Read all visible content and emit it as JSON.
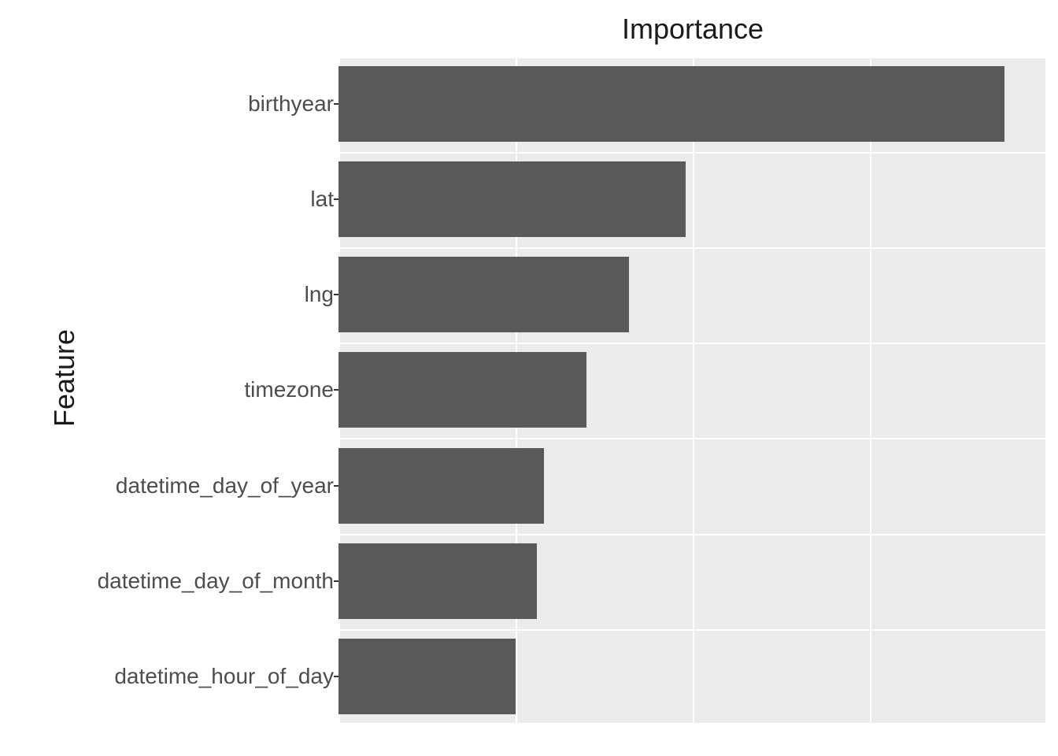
{
  "chart_data": {
    "type": "bar",
    "title": "Importance",
    "ylabel": "Feature",
    "xlabel": "",
    "xlim": [
      0,
      1.0
    ],
    "categories": [
      "birthyear",
      "lat",
      "lng",
      "timezone",
      "datetime_day_of_year",
      "datetime_day_of_month",
      "datetime_hour_of_day"
    ],
    "values": [
      0.94,
      0.49,
      0.41,
      0.35,
      0.29,
      0.28,
      0.25
    ],
    "grid_major_x": [
      0.0,
      0.25,
      0.5,
      0.75,
      1.0
    ],
    "bar_color": "#595959",
    "panel_bg": "#EBEBEB"
  }
}
